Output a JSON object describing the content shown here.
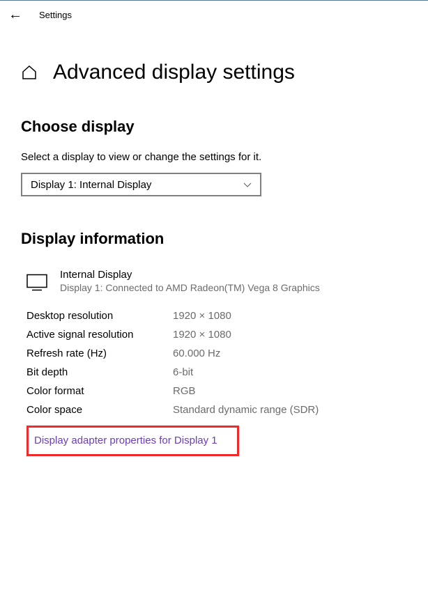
{
  "header": {
    "title": "Settings"
  },
  "page": {
    "title": "Advanced display settings"
  },
  "choose": {
    "heading": "Choose display",
    "desc": "Select a display to view or change the settings for it.",
    "dropdown_value": "Display 1: Internal Display"
  },
  "info": {
    "heading": "Display information",
    "display_name": "Internal Display",
    "display_sub": "Display 1: Connected to AMD Radeon(TM) Vega 8 Graphics",
    "rows": [
      {
        "label": "Desktop resolution",
        "value": "1920 × 1080"
      },
      {
        "label": "Active signal resolution",
        "value": "1920 × 1080"
      },
      {
        "label": "Refresh rate (Hz)",
        "value": "60.000 Hz"
      },
      {
        "label": "Bit depth",
        "value": "6-bit"
      },
      {
        "label": "Color format",
        "value": "RGB"
      },
      {
        "label": "Color space",
        "value": "Standard dynamic range (SDR)"
      }
    ],
    "link": "Display adapter properties for Display 1"
  }
}
